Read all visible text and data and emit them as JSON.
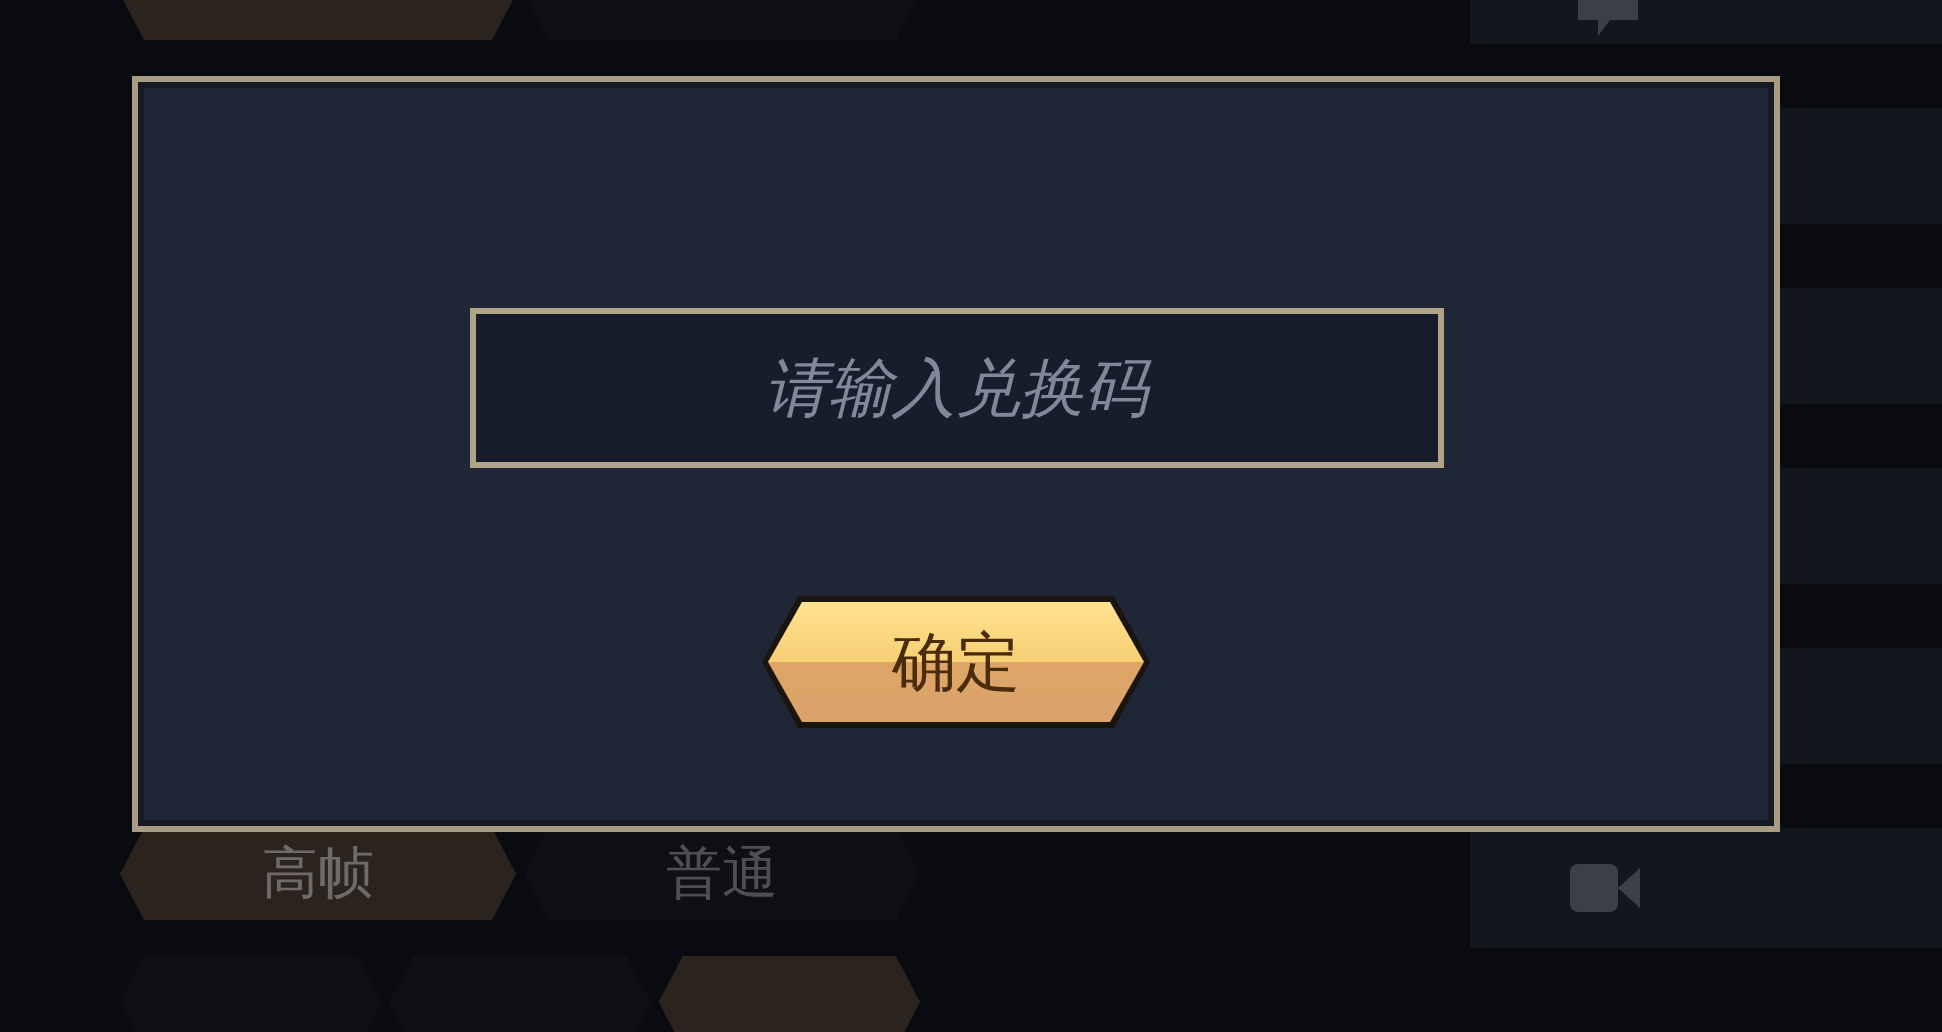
{
  "settings": [
    {
      "options": [
        {
          "selected": true
        },
        {
          "selected": false
        }
      ]
    },
    {
      "options": [
        {
          "label": "高帧",
          "selected": true
        },
        {
          "label": "普通",
          "selected": false
        }
      ]
    },
    {
      "options": [
        {
          "selected": false
        },
        {
          "selected": false
        },
        {
          "selected": true
        }
      ]
    }
  ],
  "dialog": {
    "code_field": {
      "placeholder": "请输入兑换码"
    },
    "confirm_button": "确定"
  }
}
